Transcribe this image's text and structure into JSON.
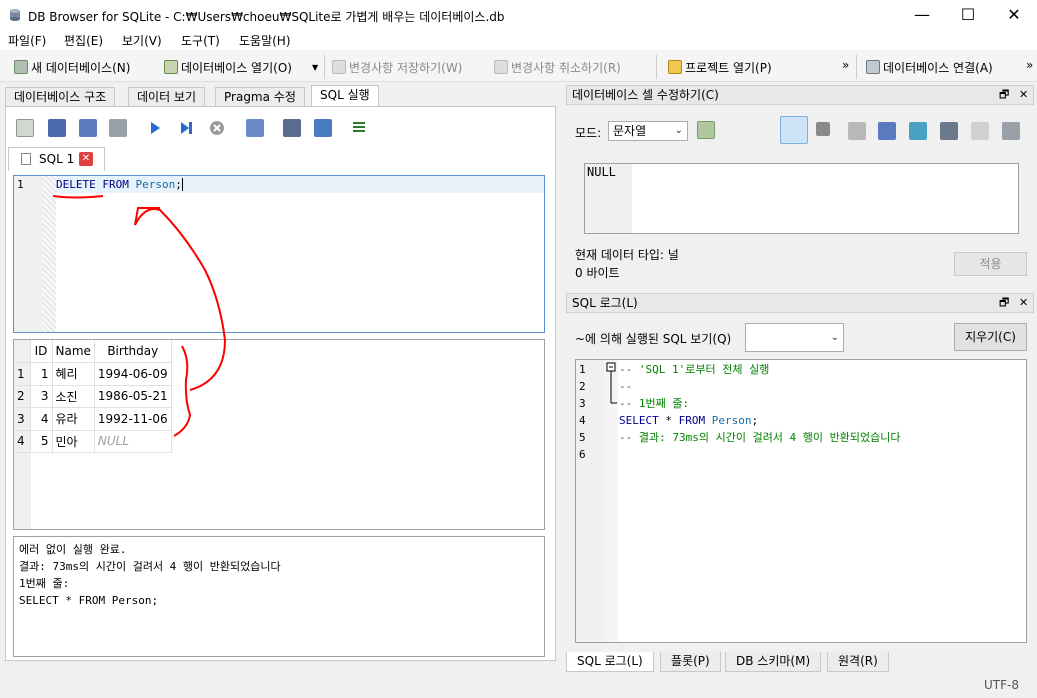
{
  "window": {
    "title": "DB Browser for SQLite - C:₩Users₩choeu₩SQLite로 가볍게 배우는 데이터베이스.db",
    "minimize": "—",
    "maximize": "☐",
    "close": "✕"
  },
  "menu": [
    "파일(F)",
    "편집(E)",
    "보기(V)",
    "도구(T)",
    "도움말(H)"
  ],
  "toolbar": {
    "new_db": "새 데이터베이스(N)",
    "open_db": "데이터베이스 열기(O)",
    "write_changes": "변경사항 저장하기(W)",
    "revert_changes": "변경사항 취소하기(R)",
    "open_project": "프로젝트 열기(P)",
    "more1": "»",
    "attach_db": "데이터베이스 연결(A)",
    "more2": "»"
  },
  "left_tabs": [
    "데이터베이스 구조",
    "데이터 보기",
    "Pragma 수정",
    "SQL 실행"
  ],
  "sql_tab": {
    "label": "SQL 1",
    "close": "✕"
  },
  "editor": {
    "line_number": "1",
    "kw_delete": "DELETE",
    "kw_from": "FROM",
    "table": "Person",
    "semicolon": ";"
  },
  "results": {
    "columns": [
      "ID",
      "Name",
      "Birthday"
    ],
    "rows": [
      {
        "row": "1",
        "id": "1",
        "name": "혜리",
        "birthday": "1994-06-09"
      },
      {
        "row": "2",
        "id": "3",
        "name": "소진",
        "birthday": "1986-05-21"
      },
      {
        "row": "3",
        "id": "4",
        "name": "유라",
        "birthday": "1992-11-06"
      },
      {
        "row": "4",
        "id": "5",
        "name": "민아",
        "birthday": "NULL"
      }
    ]
  },
  "messages": {
    "line1": "에러 없이 실행 완료.",
    "line2": "결과: 73ms의 시간이 걸려서 4 행이 반환되었습니다",
    "line3": "1번째 줄:",
    "line4": "SELECT * FROM Person;"
  },
  "cell_editor": {
    "title": "데이터베이스 셀 수정하기(C)",
    "float": "🗗",
    "close": "✕",
    "mode_label": "모드:",
    "mode_value": "문자열",
    "value": "NULL",
    "type_label": "현재 데이터 타입: 널",
    "size_label": "0 바이트",
    "apply": "적용"
  },
  "sql_log": {
    "title": "SQL 로그(L)",
    "float": "🗗",
    "close": "✕",
    "show_label": "~에 의해 실행된 SQL 보기(Q)",
    "clear": "지우기(C)",
    "line_numbers": "1\n2\n3\n4\n5\n6",
    "l1": "-- 'SQL 1'로부터 전체 실행",
    "l2": "--",
    "l3": "-- 1번째 줄:",
    "l4_select": "SELECT",
    "l4_star": " * ",
    "l4_from": "FROM",
    "l4_table": "Person",
    "l4_end": ";",
    "l5": "-- 결과: 73ms의 시간이 걸려서 4 행이 반환되었습니다"
  },
  "bottom_tabs": [
    "SQL 로그(L)",
    "플롯(P)",
    "DB 스키마(M)",
    "원격(R)"
  ],
  "status": {
    "encoding": "UTF-8"
  },
  "colors": {
    "annotation": "#ff0000",
    "editor_border": "#5a8fd0",
    "keyword": "#00008b",
    "comment": "#008000"
  }
}
